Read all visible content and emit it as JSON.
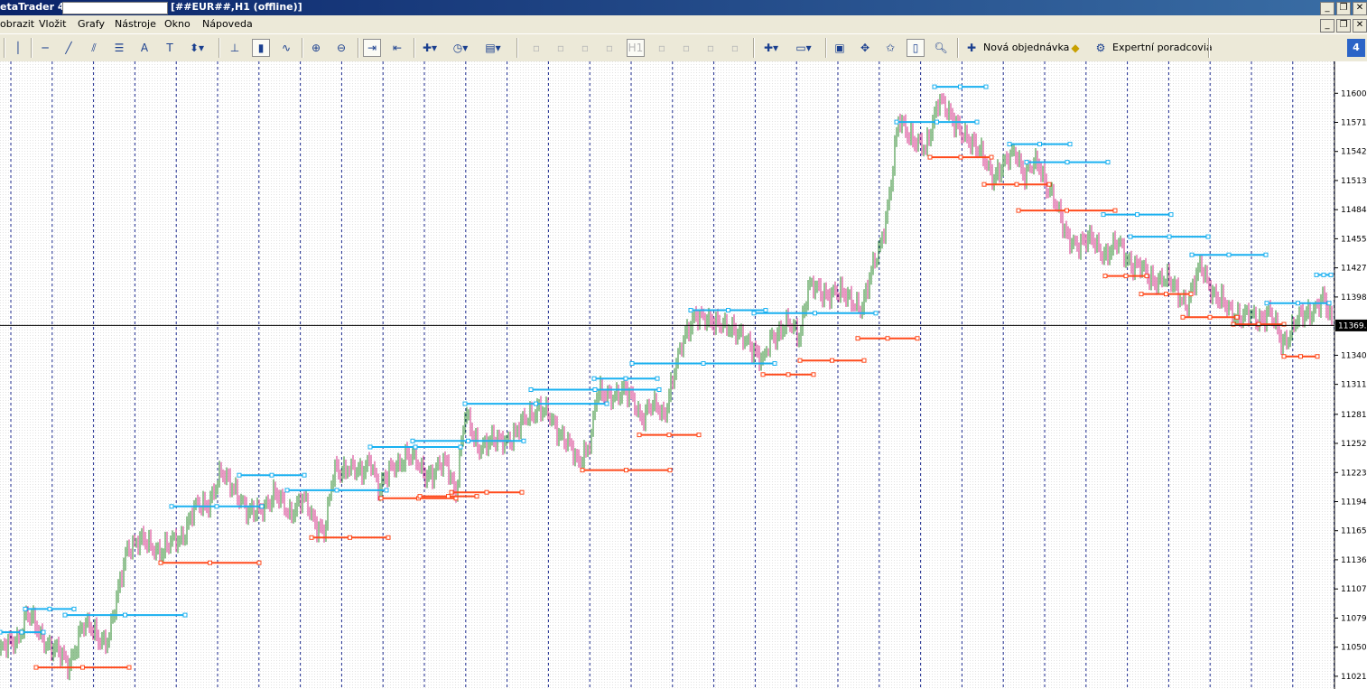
{
  "window": {
    "title_prefix": "etaTrader 4",
    "title_suffix": "[##EUR##,H1 (offline)]"
  },
  "menu": {
    "items": [
      "obrazit",
      "Vložit",
      "Grafy",
      "Nástroje",
      "Okno",
      "Nápoveda"
    ]
  },
  "toolbar": {
    "timeframe_disabled": "H1",
    "new_order_label": "Nová objednávka",
    "expert_label": "Expertní poradcovia",
    "badge": "4"
  },
  "chart_data": {
    "type": "bar",
    "symbol": "##EUR##",
    "timeframe": "H1",
    "current_price": "11369.8",
    "ylim": [
      11013,
      11625
    ],
    "y_ticks": [
      {
        "v": 11600.5,
        "l": "11600.5"
      },
      {
        "v": 11571.6,
        "l": "11571.6"
      },
      {
        "v": 11542.7,
        "l": "11542.7"
      },
      {
        "v": 11513.8,
        "l": "11513.8"
      },
      {
        "v": 11484.8,
        "l": "11484.8"
      },
      {
        "v": 11455.9,
        "l": "11455.9"
      },
      {
        "v": 11427.0,
        "l": "11427.0"
      },
      {
        "v": 11398.1,
        "l": "11398.1"
      },
      {
        "v": 11340.2,
        "l": "11340.2"
      },
      {
        "v": 11311.3,
        "l": "11311.3"
      },
      {
        "v": 11281.5,
        "l": "11281.5"
      },
      {
        "v": 11252.6,
        "l": "11252.6"
      },
      {
        "v": 11223.6,
        "l": "11223.6"
      },
      {
        "v": 11194.7,
        "l": "11194.7"
      },
      {
        "v": 11165.8,
        "l": "11165.8"
      },
      {
        "v": 11136.9,
        "l": "11136.9"
      },
      {
        "v": 11107.9,
        "l": "11107.9"
      },
      {
        "v": 11079.0,
        "l": "11079.0"
      },
      {
        "v": 11050.1,
        "l": "11050.1"
      },
      {
        "v": 11021.2,
        "l": "11021.2"
      }
    ],
    "price_path": [
      [
        0,
        11045
      ],
      [
        20,
        11060
      ],
      [
        30,
        11085
      ],
      [
        45,
        11060
      ],
      [
        60,
        11050
      ],
      [
        75,
        11030
      ],
      [
        90,
        11070
      ],
      [
        105,
        11065
      ],
      [
        120,
        11055
      ],
      [
        130,
        11100
      ],
      [
        140,
        11150
      ],
      [
        160,
        11155
      ],
      [
        180,
        11145
      ],
      [
        200,
        11160
      ],
      [
        215,
        11185
      ],
      [
        230,
        11195
      ],
      [
        245,
        11220
      ],
      [
        260,
        11210
      ],
      [
        275,
        11180
      ],
      [
        290,
        11190
      ],
      [
        305,
        11200
      ],
      [
        320,
        11185
      ],
      [
        335,
        11195
      ],
      [
        350,
        11175
      ],
      [
        360,
        11165
      ],
      [
        370,
        11225
      ],
      [
        385,
        11230
      ],
      [
        400,
        11220
      ],
      [
        410,
        11240
      ],
      [
        420,
        11205
      ],
      [
        435,
        11230
      ],
      [
        450,
        11240
      ],
      [
        465,
        11230
      ],
      [
        480,
        11220
      ],
      [
        495,
        11235
      ],
      [
        505,
        11205
      ],
      [
        515,
        11280
      ],
      [
        530,
        11250
      ],
      [
        550,
        11255
      ],
      [
        570,
        11260
      ],
      [
        585,
        11280
      ],
      [
        595,
        11290
      ],
      [
        610,
        11275
      ],
      [
        625,
        11260
      ],
      [
        640,
        11230
      ],
      [
        655,
        11260
      ],
      [
        660,
        11300
      ],
      [
        675,
        11300
      ],
      [
        690,
        11305
      ],
      [
        700,
        11295
      ],
      [
        710,
        11280
      ],
      [
        720,
        11290
      ],
      [
        735,
        11280
      ],
      [
        745,
        11320
      ],
      [
        760,
        11360
      ],
      [
        770,
        11385
      ],
      [
        785,
        11370
      ],
      [
        800,
        11375
      ],
      [
        815,
        11360
      ],
      [
        830,
        11355
      ],
      [
        845,
        11330
      ],
      [
        855,
        11360
      ],
      [
        870,
        11370
      ],
      [
        885,
        11360
      ],
      [
        895,
        11410
      ],
      [
        910,
        11400
      ],
      [
        925,
        11405
      ],
      [
        940,
        11395
      ],
      [
        955,
        11390
      ],
      [
        965,
        11420
      ],
      [
        975,
        11450
      ],
      [
        985,
        11500
      ],
      [
        995,
        11570
      ],
      [
        1010,
        11560
      ],
      [
        1025,
        11540
      ],
      [
        1040,
        11600
      ],
      [
        1055,
        11570
      ],
      [
        1070,
        11560
      ],
      [
        1085,
        11540
      ],
      [
        1100,
        11520
      ],
      [
        1115,
        11530
      ],
      [
        1125,
        11545
      ],
      [
        1135,
        11520
      ],
      [
        1150,
        11530
      ],
      [
        1165,
        11500
      ],
      [
        1180,
        11460
      ],
      [
        1195,
        11450
      ],
      [
        1210,
        11455
      ],
      [
        1225,
        11440
      ],
      [
        1240,
        11450
      ],
      [
        1255,
        11430
      ],
      [
        1270,
        11420
      ],
      [
        1285,
        11415
      ],
      [
        1300,
        11410
      ],
      [
        1315,
        11390
      ],
      [
        1330,
        11430
      ],
      [
        1345,
        11400
      ],
      [
        1360,
        11385
      ],
      [
        1375,
        11380
      ],
      [
        1390,
        11375
      ],
      [
        1405,
        11385
      ],
      [
        1420,
        11350
      ],
      [
        1435,
        11375
      ],
      [
        1450,
        11380
      ],
      [
        1465,
        11400
      ],
      [
        1475,
        11370
      ]
    ],
    "resistance_levels": [
      [
        0,
        48,
        11065
      ],
      [
        28,
        82,
        11088
      ],
      [
        72,
        205,
        11082
      ],
      [
        190,
        290,
        11190
      ],
      [
        265,
        337,
        11221
      ],
      [
        318,
        428,
        11206
      ],
      [
        410,
        510,
        11249
      ],
      [
        457,
        580,
        11255
      ],
      [
        515,
        672,
        11292
      ],
      [
        588,
        730,
        11306
      ],
      [
        658,
        728,
        11317
      ],
      [
        700,
        858,
        11332
      ],
      [
        765,
        848,
        11385
      ],
      [
        835,
        970,
        11382
      ],
      [
        993,
        1082,
        11572
      ],
      [
        1035,
        1092,
        11607
      ],
      [
        1118,
        1185,
        11550
      ],
      [
        1137,
        1227,
        11532
      ],
      [
        1222,
        1297,
        11480
      ],
      [
        1252,
        1338,
        11458
      ],
      [
        1320,
        1402,
        11440
      ],
      [
        1403,
        1472,
        11392
      ],
      [
        1458,
        1474,
        11420
      ]
    ],
    "support_levels": [
      [
        40,
        143,
        11030
      ],
      [
        178,
        287,
        11134
      ],
      [
        345,
        430,
        11159
      ],
      [
        422,
        505,
        11198
      ],
      [
        465,
        528,
        11200
      ],
      [
        500,
        578,
        11204
      ],
      [
        645,
        742,
        11226
      ],
      [
        708,
        774,
        11261
      ],
      [
        845,
        901,
        11321
      ],
      [
        886,
        957,
        11335
      ],
      [
        950,
        1016,
        11357
      ],
      [
        1030,
        1098,
        11537
      ],
      [
        1090,
        1162,
        11510
      ],
      [
        1128,
        1235,
        11484
      ],
      [
        1224,
        1270,
        11419
      ],
      [
        1264,
        1319,
        11401
      ],
      [
        1310,
        1370,
        11378
      ],
      [
        1366,
        1422,
        11371
      ],
      [
        1422,
        1459,
        11339
      ]
    ]
  }
}
